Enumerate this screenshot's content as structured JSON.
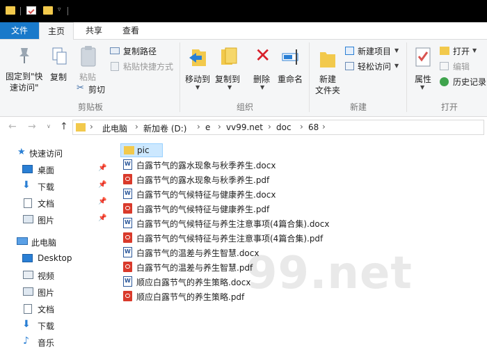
{
  "tabs": {
    "file": "文件",
    "home": "主页",
    "share": "共享",
    "view": "查看"
  },
  "ribbon": {
    "pin_quick_access_l1": "固定到\"快",
    "pin_quick_access_l2": "速访问\"",
    "copy": "复制",
    "paste": "粘贴",
    "copy_path": "复制路径",
    "paste_shortcut": "粘贴快捷方式",
    "cut": "剪切",
    "clipboard_group": "剪贴板",
    "move_to": "移动到",
    "copy_to": "复制到",
    "delete": "删除",
    "rename": "重命名",
    "organize_group": "组织",
    "new_item": "新建项目",
    "easy_access": "轻松访问",
    "new_folder_l1": "新建",
    "new_folder_l2": "文件夹",
    "new_group": "新建",
    "open": "打开",
    "edit": "编辑",
    "history": "历史记录",
    "properties": "属性",
    "open_group": "打开"
  },
  "address": {
    "crumbs": [
      "此电脑",
      "新加卷 (D:)",
      "e",
      "vv99.net",
      "doc",
      "68"
    ]
  },
  "nav": {
    "quick_access": "快速访问",
    "desktop_cn": "桌面",
    "downloads": "下载",
    "documents": "文档",
    "pictures": "图片",
    "this_pc": "此电脑",
    "desktop_en": "Desktop",
    "videos": "视频",
    "pictures2": "图片",
    "documents2": "文档",
    "downloads2": "下载",
    "music": "音乐"
  },
  "files": [
    "pic",
    "白露节气的露水现象与秋季养生.docx",
    "白露节气的露水现象与秋季养生.pdf",
    "白露节气的气候特征与健康养生.docx",
    "白露节气的气候特征与健康养生.pdf",
    "白露节气的气候特征与养生注意事项(4篇合集).docx",
    "白露节气的气候特征与养生注意事项(4篇合集).pdf",
    "白露节气的温差与养生智慧.docx",
    "白露节气的温差与养生智慧.pdf",
    "顺应白露节气的养生策略.docx",
    "顺应白露节气的养生策略.pdf"
  ],
  "watermark": "99.net",
  "colors": {
    "accent": "#1979ca",
    "folder": "#f2c94c",
    "pdf": "#d93a2b",
    "word": "#2b579a"
  }
}
